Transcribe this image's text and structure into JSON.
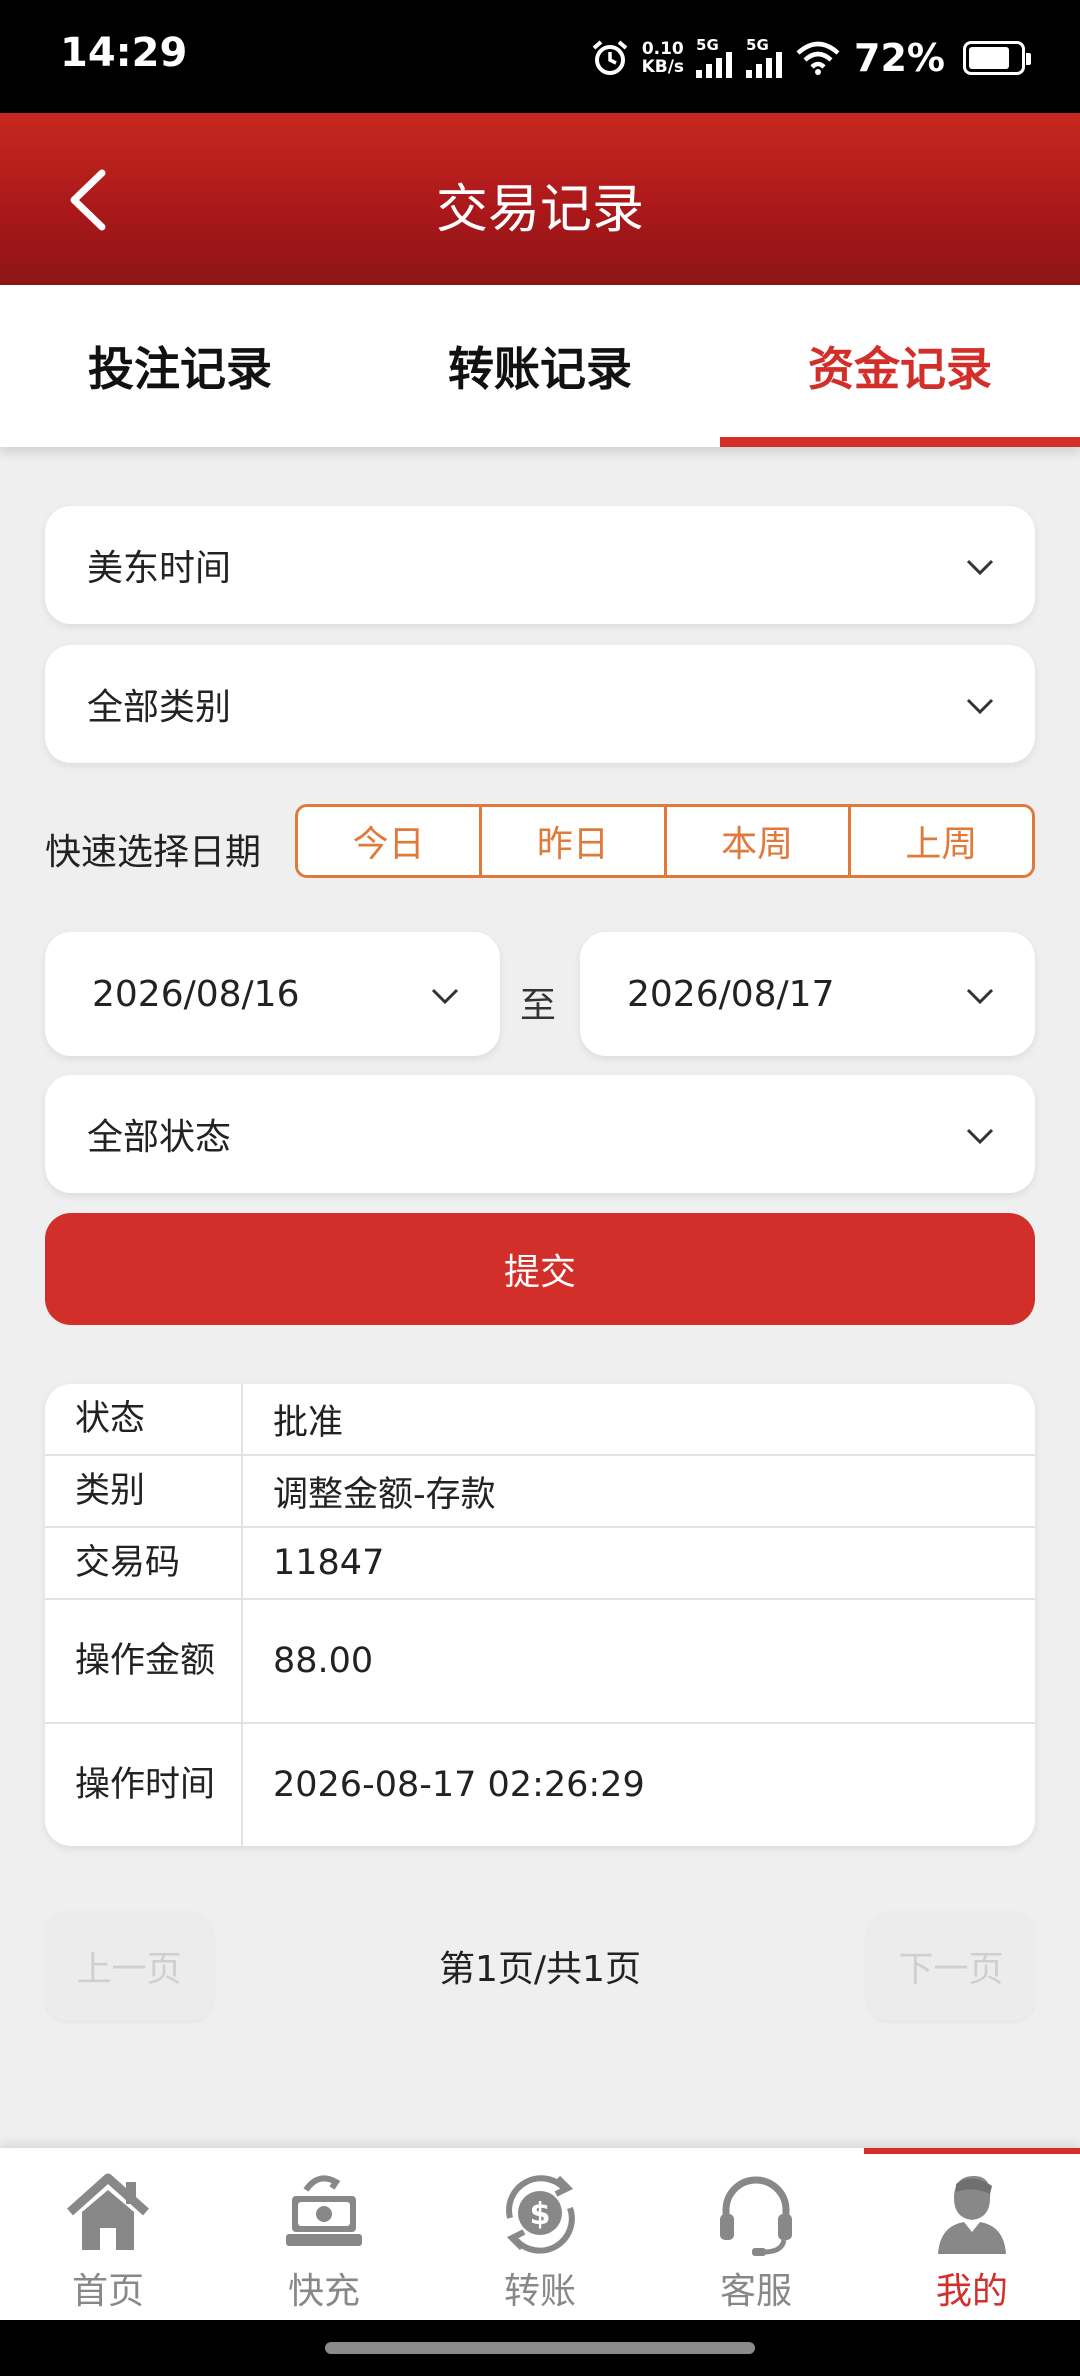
{
  "status_bar": {
    "time": "14:29",
    "net_speed_value": "0.10",
    "net_speed_unit": "KB/s",
    "sim1": "5G",
    "sim2": "5G",
    "battery": "72%"
  },
  "header": {
    "title": "交易记录"
  },
  "tabs": [
    {
      "label": "投注记录",
      "active": false
    },
    {
      "label": "转账记录",
      "active": false
    },
    {
      "label": "资金记录",
      "active": true
    }
  ],
  "filters": {
    "timezone": "美东时间",
    "category": "全部类别",
    "quick_label": "快速选择日期",
    "quick_options": [
      "今日",
      "昨日",
      "本周",
      "上周"
    ],
    "date_from": "2026/08/16",
    "date_to_label": "至",
    "date_to": "2026/08/17",
    "status": "全部状态",
    "submit": "提交"
  },
  "record": {
    "rows": [
      {
        "key": "状态",
        "value": "批准"
      },
      {
        "key": "类别",
        "value": "调整金额-存款"
      },
      {
        "key": "交易码",
        "value": "11847"
      },
      {
        "key": "操作金额",
        "value": "88.00"
      },
      {
        "key": "操作时间",
        "value": "2026-08-17 02:26:29"
      }
    ]
  },
  "pager": {
    "prev": "上一页",
    "info": "第1页/共1页",
    "next": "下一页"
  },
  "bottom_nav": [
    {
      "label": "首页",
      "icon": "home-icon",
      "active": false
    },
    {
      "label": "快充",
      "icon": "cash-icon",
      "active": false
    },
    {
      "label": "转账",
      "icon": "transfer-icon",
      "active": false
    },
    {
      "label": "客服",
      "icon": "headset-icon",
      "active": false
    },
    {
      "label": "我的",
      "icon": "user-icon",
      "active": true
    }
  ],
  "colors": {
    "brand_red": "#d32f2a",
    "quick_orange": "#e07a3a"
  }
}
